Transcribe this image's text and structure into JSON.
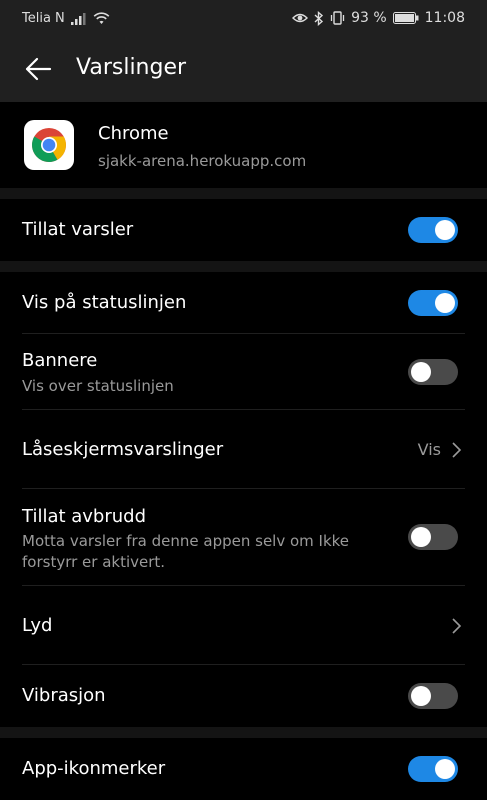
{
  "status_bar": {
    "carrier": "Telia N",
    "battery_percent": "93 %",
    "time": "11:08",
    "icons": [
      "signal-icon",
      "wifi-icon",
      "eye-icon",
      "bluetooth-icon",
      "vibrate-icon",
      "battery-icon"
    ]
  },
  "app_bar": {
    "title": "Varslinger",
    "back_icon": "arrow-left-icon"
  },
  "app_info": {
    "name": "Chrome",
    "subtitle": "sjakk-arena.herokuapp.com",
    "icon": "chrome-logo"
  },
  "settings": {
    "allow_notifications": {
      "label": "Tillat varsler",
      "enabled": true
    },
    "show_statusbar": {
      "label": "Vis på statuslinjen",
      "enabled": true
    },
    "banners": {
      "label": "Bannere",
      "sublabel": "Vis over statuslinjen",
      "enabled": false
    },
    "lockscreen": {
      "label": "Låseskjermsvarslinger",
      "value": "Vis"
    },
    "allow_interruptions": {
      "label": "Tillat avbrudd",
      "sublabel": "Motta varsler fra denne appen selv om Ikke forstyrr er aktivert.",
      "enabled": false
    },
    "sound": {
      "label": "Lyd"
    },
    "vibration": {
      "label": "Vibrasjon",
      "enabled": false
    },
    "app_badges": {
      "label": "App-ikonmerker",
      "enabled": true
    }
  },
  "colors": {
    "accent": "#1e88e5",
    "toggle_off": "#4a4a4a",
    "background": "#000000",
    "bar": "#202020"
  }
}
